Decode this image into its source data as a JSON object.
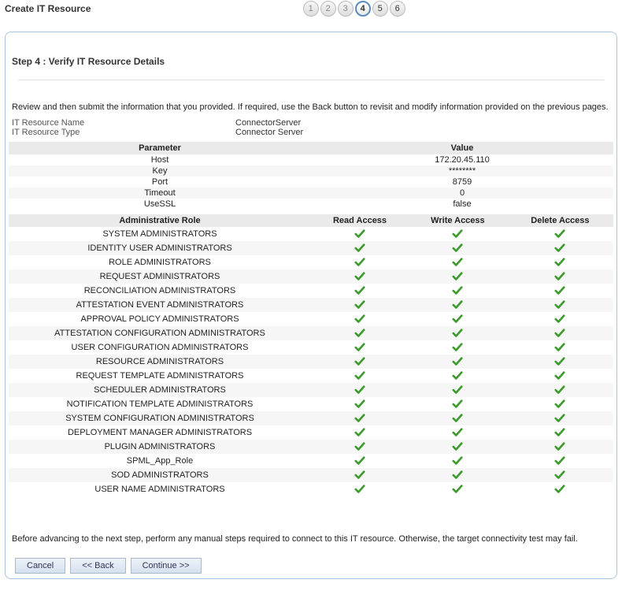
{
  "page_title": "Create IT Resource",
  "steps": [
    {
      "n": "1",
      "state": "done"
    },
    {
      "n": "2",
      "state": "done"
    },
    {
      "n": "3",
      "state": "done"
    },
    {
      "n": "4",
      "state": "active"
    },
    {
      "n": "5",
      "state": "todo"
    },
    {
      "n": "6",
      "state": "todo"
    }
  ],
  "step_heading": "Step 4 : Verify IT Resource Details",
  "intro": "Review and then submit the information that you provided. If required, use the Back button to revisit and modify information provided on the previous pages.",
  "meta": {
    "name_label": "IT Resource Name",
    "name_value": "ConnectorServer",
    "type_label": "IT Resource Type",
    "type_value": "Connector Server"
  },
  "param_header": {
    "param": "Parameter",
    "value": "Value"
  },
  "params": [
    {
      "param": "Host",
      "value": "172.20.45.110"
    },
    {
      "param": "Key",
      "value": "********"
    },
    {
      "param": "Port",
      "value": "8759"
    },
    {
      "param": "Timeout",
      "value": "0"
    },
    {
      "param": "UseSSL",
      "value": "false"
    }
  ],
  "role_header": {
    "role": "Administrative Role",
    "read": "Read Access",
    "write": "Write Access",
    "del": "Delete Access"
  },
  "roles": [
    {
      "role": "SYSTEM ADMINISTRATORS",
      "read": true,
      "write": true,
      "del": true
    },
    {
      "role": "IDENTITY USER ADMINISTRATORS",
      "read": true,
      "write": true,
      "del": true
    },
    {
      "role": "ROLE ADMINISTRATORS",
      "read": true,
      "write": true,
      "del": true
    },
    {
      "role": "REQUEST ADMINISTRATORS",
      "read": true,
      "write": true,
      "del": true
    },
    {
      "role": "RECONCILIATION ADMINISTRATORS",
      "read": true,
      "write": true,
      "del": true
    },
    {
      "role": "ATTESTATION EVENT ADMINISTRATORS",
      "read": true,
      "write": true,
      "del": true
    },
    {
      "role": "APPROVAL POLICY ADMINISTRATORS",
      "read": true,
      "write": true,
      "del": true
    },
    {
      "role": "ATTESTATION CONFIGURATION ADMINISTRATORS",
      "read": true,
      "write": true,
      "del": true
    },
    {
      "role": "USER CONFIGURATION ADMINISTRATORS",
      "read": true,
      "write": true,
      "del": true
    },
    {
      "role": "RESOURCE ADMINISTRATORS",
      "read": true,
      "write": true,
      "del": true
    },
    {
      "role": "REQUEST TEMPLATE ADMINISTRATORS",
      "read": true,
      "write": true,
      "del": true
    },
    {
      "role": "SCHEDULER ADMINISTRATORS",
      "read": true,
      "write": true,
      "del": true
    },
    {
      "role": "NOTIFICATION TEMPLATE ADMINISTRATORS",
      "read": true,
      "write": true,
      "del": true
    },
    {
      "role": "SYSTEM CONFIGURATION ADMINISTRATORS",
      "read": true,
      "write": true,
      "del": true
    },
    {
      "role": "DEPLOYMENT MANAGER ADMINISTRATORS",
      "read": true,
      "write": true,
      "del": true
    },
    {
      "role": "PLUGIN ADMINISTRATORS",
      "read": true,
      "write": true,
      "del": true
    },
    {
      "role": "SPML_App_Role",
      "read": true,
      "write": true,
      "del": true
    },
    {
      "role": "SOD ADMINISTRATORS",
      "read": true,
      "write": true,
      "del": true
    },
    {
      "role": "USER NAME ADMINISTRATORS",
      "read": true,
      "write": true,
      "del": true
    }
  ],
  "footnote": "Before advancing to the next step, perform any manual steps required to connect to this IT resource. Otherwise, the target connectivity test may fail.",
  "buttons": {
    "cancel": "Cancel",
    "back": "<< Back",
    "continue": "Continue >>"
  }
}
